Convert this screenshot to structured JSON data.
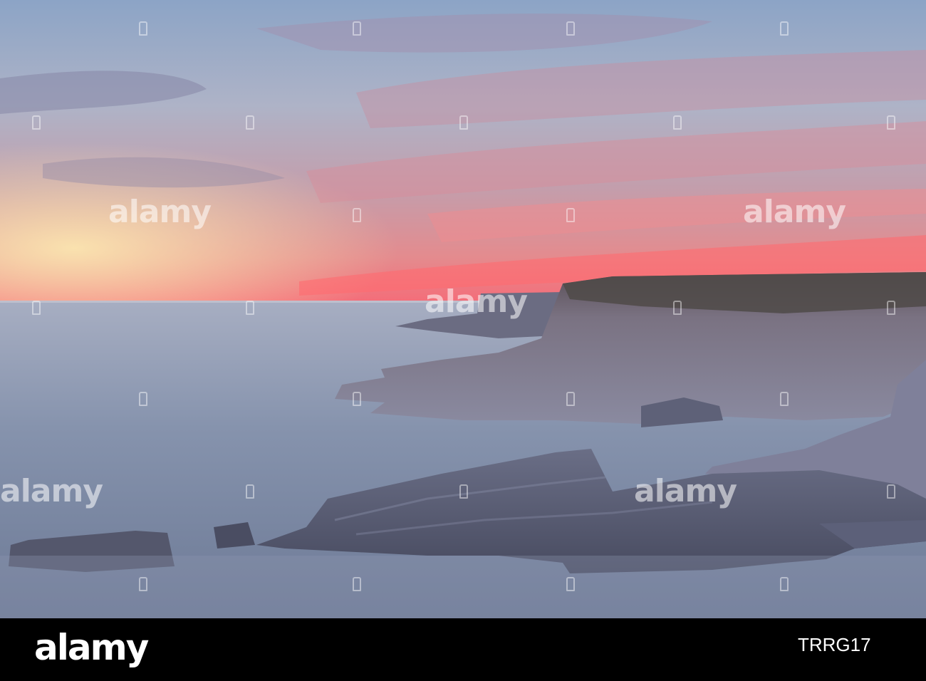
{
  "image": {
    "sky_colors": [
      "#8fa6c6",
      "#b3b7c8",
      "#c7a6ad",
      "#e28b88",
      "#ff6470"
    ],
    "sea_color": "#7c8aa4",
    "rock_color": "#5b5f74"
  },
  "watermark": {
    "brand": "alamy",
    "id": "TRRG17"
  }
}
